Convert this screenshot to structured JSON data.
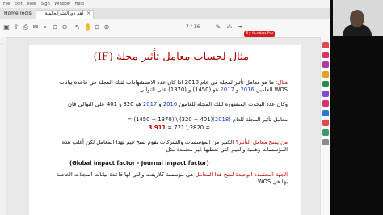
{
  "menubar": {
    "items": [
      "File",
      "Edit",
      "View",
      "Sign",
      "Window",
      "Help"
    ]
  },
  "tabs": {
    "home": "Home",
    "tools": "Tools",
    "document": "أهم دورالنشرالعالمية"
  },
  "toolbar": {
    "page_current": "7",
    "page_sep": "/",
    "page_total": "16",
    "try_label": "Try Acrobat Pro DC"
  },
  "slide": {
    "title": "مثال لحساب معامل تأثير مجلة (IF)",
    "p1_label": "مثال:",
    "p1_text": " ما هو معامل تأثير لمجلة في عام 2018 اذا كان عدد الاستشهادات لتلك المجلة في قاعدة بيانات WOS للعامين ",
    "y2016": "2016",
    "w_and": " و ",
    "y2017": "2017",
    "p1_tail": " هو (1450) و (1370) على التوالي",
    "p2": "وكان عدد البحوث المنشورة لتلك المجلة للعامين ",
    "p2_tail": " هو 320 و 401 على التوالي فان",
    "p3": "معامل تأثير المجلة للعام ",
    "y2018": "(2018)",
    "p3_eq": " = (1450 + 1370) \\ (320 + 401)",
    "result_value": "3.911",
    "result_rest": " = 721 \\ 2820 =",
    "q_label": "من يمنح معامل التأثير؟",
    "q_text": " الكثير من المؤسسات والشركات تقوم بمنح قيم لهذا المعامل لكن أغلب هذه المؤسسات وهمية والقيم التي تعطيها غير معتمدة مثل",
    "gif": "(Global impact factor - Journal impact factor)",
    "auth_label": "الجهة المعتمدة الوحيدة لمنح هذا المعامل",
    "auth_text": " هي مؤسسة كلاريفت والتي لها قاعدة بيانات المجلات الخاصة بها هي WOS"
  },
  "colors": {
    "title_red": "#b20000",
    "accent_red": "#c00000",
    "year_blue": "#1f3fbf",
    "brand_red": "#d61c22"
  }
}
